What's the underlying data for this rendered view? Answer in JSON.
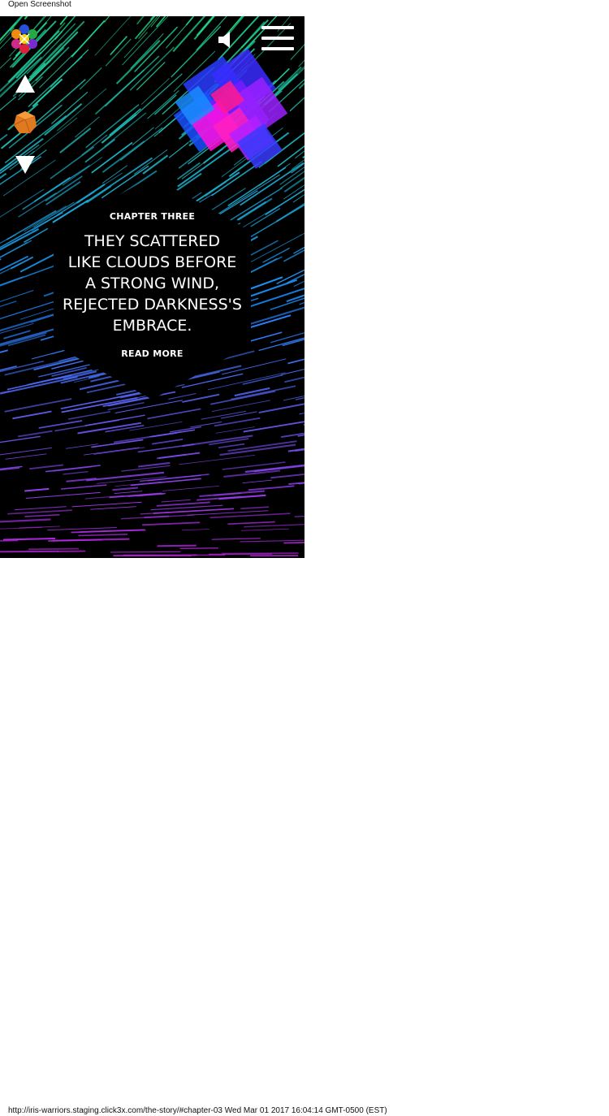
{
  "viewer": {
    "caption": "Open Screenshot",
    "footer": "http://iris-warriors.staging.click3x.com/the-story/#chapter-03 Wed Mar 01 2017 16:04:14 GMT-0500 (EST)"
  },
  "header": {
    "logo_icon": "hexagon-flower-logo-icon",
    "sound_icon": "speaker-icon",
    "menu_icon": "hamburger-menu-icon"
  },
  "chapter_nav": {
    "prev_icon": "triangle-up-icon",
    "current_icon": "orange-gem-icon",
    "next_icon": "triangle-down-icon"
  },
  "chapter": {
    "label": "CHAPTER THREE",
    "title_lines": [
      "THEY SCATTERED",
      "LIKE CLOUDS BEFORE",
      "A STRONG WIND,",
      "REJECTED DARKNESS'S",
      "EMBRACE."
    ],
    "read_more": "READ MORE"
  },
  "colors": {
    "background": "#000000",
    "streak_top": "#20e080",
    "streak_mid": "#1a8cff",
    "streak_bottom": "#c020e0",
    "nebula_pink": "#ff10e0",
    "nebula_violet": "#8a1aff",
    "gem": "#e07a20"
  }
}
